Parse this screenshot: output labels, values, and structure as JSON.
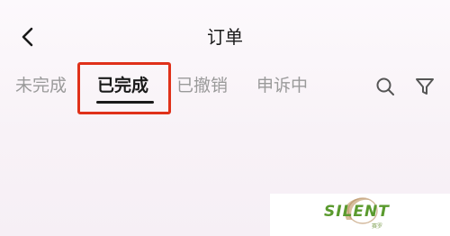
{
  "header": {
    "title": "订单",
    "back_icon": "chevron-left-icon"
  },
  "tabs": [
    {
      "label": "未完成",
      "active": false
    },
    {
      "label": "已完成",
      "active": true
    },
    {
      "label": "已撤销",
      "active": false
    },
    {
      "label": "申诉中",
      "active": false
    }
  ],
  "toolbar": {
    "search_icon": "search-icon",
    "filter_icon": "filter-icon"
  },
  "highlight_color": "#e0311a",
  "watermark": {
    "text": "SILENT",
    "subtext": "赛罗"
  }
}
